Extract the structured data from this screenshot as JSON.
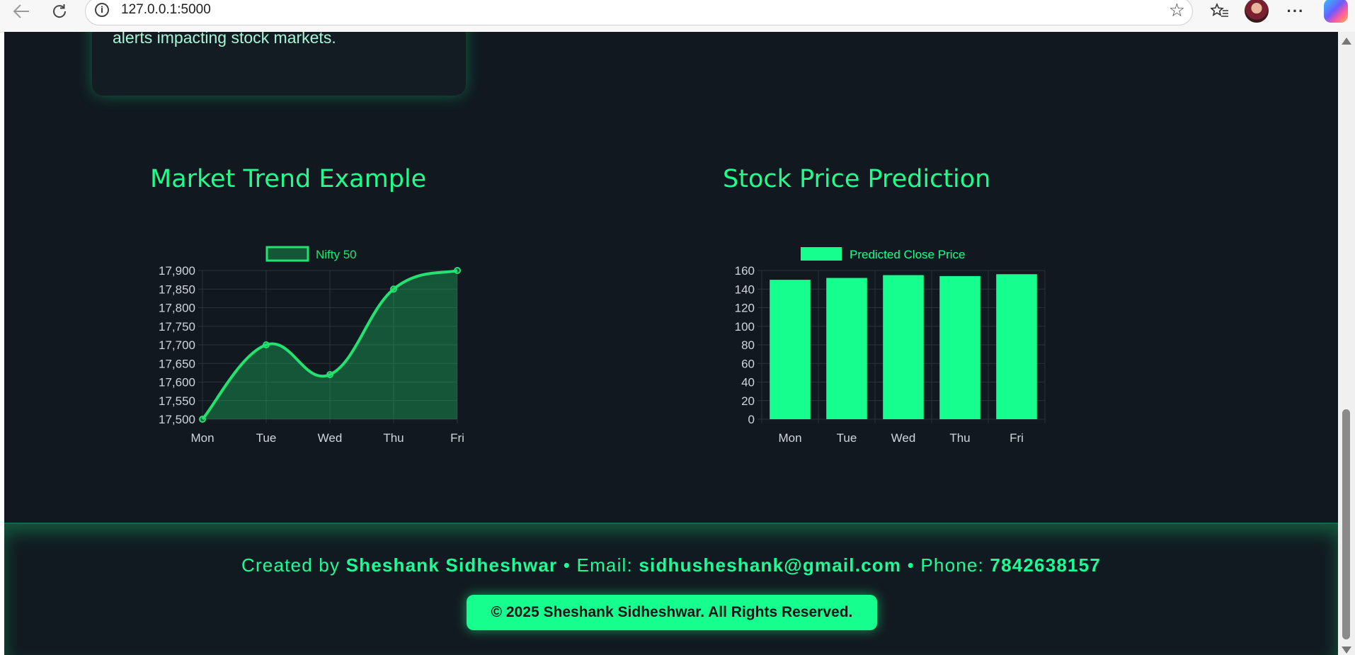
{
  "browser": {
    "url": "127.0.0.1:5000",
    "back_icon": "back-arrow-icon",
    "reload_icon": "reload-icon",
    "info_glyph": "i"
  },
  "feature": {
    "text": "alerts impacting stock markets."
  },
  "charts_titles": {
    "trend": "Market Trend Example",
    "prediction": "Stock Price Prediction"
  },
  "chart_data": [
    {
      "type": "line",
      "title": "Market Trend Example",
      "categories": [
        "Mon",
        "Tue",
        "Wed",
        "Thu",
        "Fri"
      ],
      "series": [
        {
          "name": "Nifty 50",
          "values": [
            17500,
            17700,
            17620,
            17850,
            17900
          ],
          "color": "#22e36f"
        }
      ],
      "ylim": [
        17500,
        17900
      ],
      "yticks": [
        17500,
        17550,
        17600,
        17650,
        17700,
        17750,
        17800,
        17850,
        17900
      ],
      "ytick_labels": [
        "17,500",
        "17,550",
        "17,600",
        "17,650",
        "17,700",
        "17,750",
        "17,800",
        "17,850",
        "17,900"
      ],
      "fill": true,
      "grid": true,
      "legend": "top"
    },
    {
      "type": "bar",
      "title": "Stock Price Prediction",
      "categories": [
        "Mon",
        "Tue",
        "Wed",
        "Thu",
        "Fri"
      ],
      "series": [
        {
          "name": "Predicted Close Price",
          "values": [
            150,
            152,
            155,
            154,
            156
          ],
          "color": "#16ff8e"
        }
      ],
      "ylim": [
        0,
        160
      ],
      "yticks": [
        0,
        20,
        40,
        60,
        80,
        100,
        120,
        140,
        160
      ],
      "ytick_labels": [
        "0",
        "20",
        "40",
        "60",
        "80",
        "100",
        "120",
        "140",
        "160"
      ],
      "grid": true,
      "legend": "top"
    }
  ],
  "footer": {
    "created_prefix": "Created by ",
    "author": "Sheshank Sidheshwar",
    "email_prefix": " • Email: ",
    "email": "sidhusheshank@gmail.com",
    "phone_prefix": " • Phone: ",
    "phone": "7842638157",
    "copyright": "© 2025 Sheshank Sidheshwar. All Rights Reserved."
  },
  "colors": {
    "accent": "#16ff8e",
    "background": "#111820",
    "line": "#22e36f"
  }
}
